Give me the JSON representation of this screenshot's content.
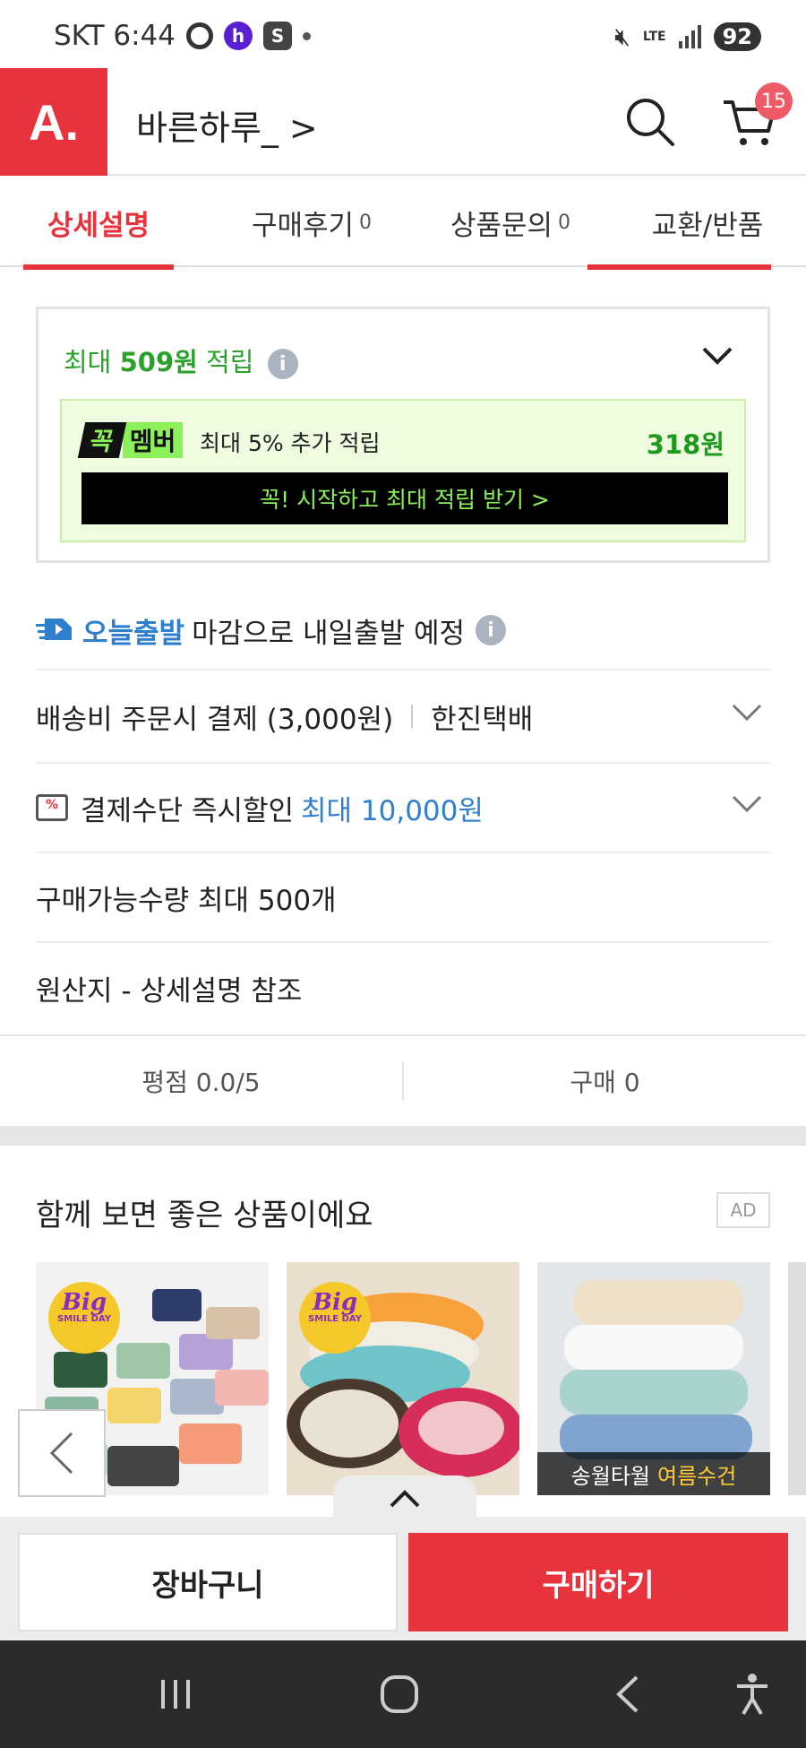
{
  "status_bar": {
    "carrier_time": "SKT 6:44",
    "network": "LTE",
    "battery": "92"
  },
  "header": {
    "logo_text": "A.",
    "store_name": "바른하루_ >",
    "cart_count": "15"
  },
  "tabs": [
    {
      "label": "상세설명",
      "count": ""
    },
    {
      "label": "구매후기",
      "count": "0"
    },
    {
      "label": "상품문의",
      "count": "0"
    },
    {
      "label": "교환/반품",
      "count": ""
    }
  ],
  "points": {
    "prefix": "최대 ",
    "amount": "509원",
    "suffix": " 적립",
    "member_badge_1": "꼭",
    "member_badge_2": "멤버",
    "member_text": "최대 5% 추가 적립",
    "member_amount": "318원",
    "member_button": "꼭! 시작하고 최대 적립 받기  >"
  },
  "delivery": {
    "tag": "오늘출발",
    "text": "마감으로 내일출발 예정"
  },
  "shipping": {
    "fee": "배송비 주문시 결제 (3,000원)",
    "carrier": "한진택배"
  },
  "payment": {
    "label": "결제수단 즉시할인",
    "discount": "최대 10,000원"
  },
  "quantity": {
    "text": "구매가능수량 최대 500개"
  },
  "origin": {
    "text": "원산지 - 상세설명 참조"
  },
  "stats": {
    "rating": "평점 0.0/5",
    "purchases": "구매 0"
  },
  "recommend": {
    "title": "함께 보면 좋은 상품이에요",
    "ad_label": "AD",
    "badge_big": "Big",
    "badge_sub": "SMILE DAY",
    "tile3_label_1": "송월타월",
    "tile3_label_2": "여름수건"
  },
  "bottom": {
    "cart_button": "장바구니",
    "buy_button": "구매하기"
  },
  "colors": {
    "brand_red": "#e8323c",
    "point_green": "#2aa12a",
    "link_blue": "#2f7fcf"
  }
}
